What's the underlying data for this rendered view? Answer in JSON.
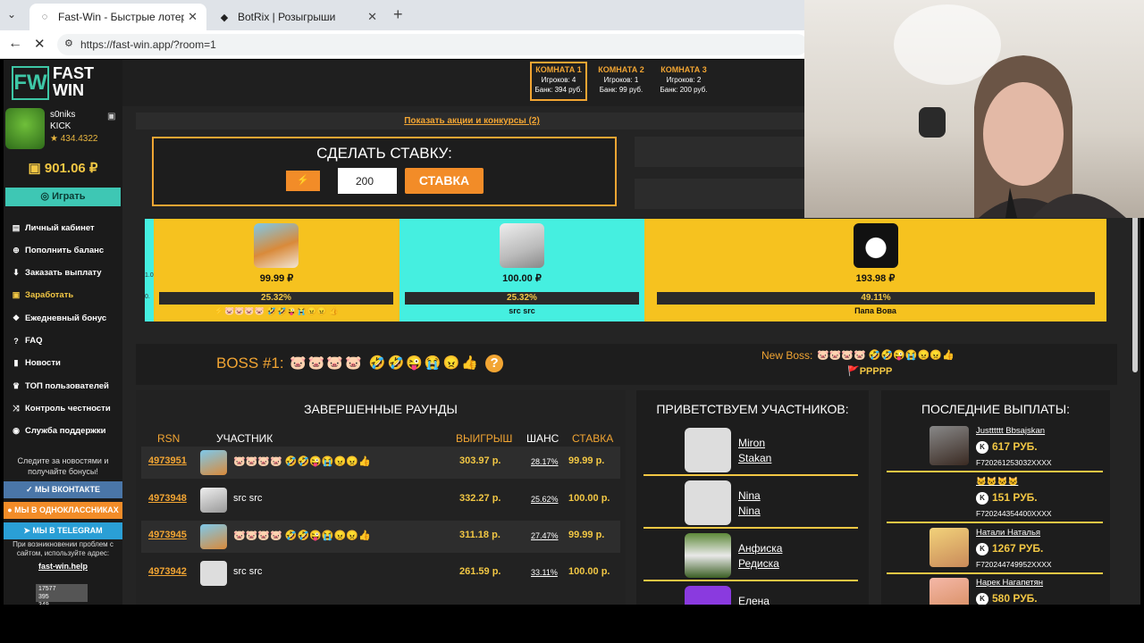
{
  "browser": {
    "tabs": [
      {
        "title": "Fast-Win - Быстрые лотереи! Ком",
        "icon": "loading-icon"
      },
      {
        "title": "BotRix | Розыгрыши",
        "icon": "botrix-icon"
      }
    ],
    "url": "https://fast-win.app/?room=1"
  },
  "logo": {
    "fw": "FW",
    "line1": "FAST",
    "line2": "WIN"
  },
  "user": {
    "name": "s0niks",
    "platform": "KICK",
    "points": "★ 434.4322",
    "balance": "901.06 ₽",
    "play": "Играть"
  },
  "menu": [
    {
      "label": "Личный кабинет",
      "icon": "wallet-icon",
      "glyph": "▤"
    },
    {
      "label": "Пополнить баланс",
      "icon": "plus-circle-icon",
      "glyph": "⊕"
    },
    {
      "label": "Заказать выплату",
      "icon": "download-icon",
      "glyph": "⬇"
    },
    {
      "label": "Заработать",
      "icon": "cash-icon",
      "glyph": "▣"
    },
    {
      "label": "Ежедневный бонус",
      "icon": "gift-icon",
      "glyph": "❖"
    },
    {
      "label": "FAQ",
      "icon": "question-icon",
      "glyph": "?"
    },
    {
      "label": "Новости",
      "icon": "bookmark-icon",
      "glyph": "▮"
    },
    {
      "label": "ТОП пользователей",
      "icon": "trophy-icon",
      "glyph": "♛"
    },
    {
      "label": "Контроль честности",
      "icon": "shuffle-icon",
      "glyph": "⤨"
    },
    {
      "label": "Служба поддержки",
      "icon": "support-icon",
      "glyph": "◉"
    }
  ],
  "follow": {
    "line1": "Следите за новостями и",
    "line2": "получайте бонусы!"
  },
  "social": [
    {
      "label": "МЫ ВКОНТАКТЕ",
      "color": "#4a76a8"
    },
    {
      "label": "МЫ В ОДНОКЛАССНИКАХ",
      "color": "#f28c28"
    },
    {
      "label": "МЫ В TELEGRAM",
      "color": "#2a9fd6"
    }
  ],
  "help": {
    "line1": "При возникновении проблем с",
    "line2": "сайтом, используйте адрес:",
    "link": "fast-win.help"
  },
  "badge": {
    "line1": "17577",
    "line2": "395",
    "line3": "349"
  },
  "rooms": [
    {
      "name": "КОМНАТА 1",
      "players": "Игроков: 4",
      "bank": "Банк: 394 руб."
    },
    {
      "name": "КОМНАТА 2",
      "players": "Игроков: 1",
      "bank": "Банк: 99 руб."
    },
    {
      "name": "КОМНАТА 3",
      "players": "Игроков: 2",
      "bank": "Банк: 200 руб."
    }
  ],
  "promo": "Показать акции и конкурсы (2)",
  "bet": {
    "title": "СДЕЛАТЬ СТАВКУ:",
    "value": "200",
    "button": "СТАВКА",
    "bolt": "⚡"
  },
  "players": [
    {
      "amount": "99.99 ₽",
      "percent": "25.32%",
      "share": 0.2532,
      "name": "⚡🐷🐷🐷🐷 🤣🤣😜😭😠😠 👍",
      "bg": "#f6c21f",
      "bar": "#2a2a2a"
    },
    {
      "amount": "100.00 ₽",
      "percent": "25.32%",
      "share": 0.2532,
      "name": "src src",
      "bg": "#45efe0",
      "bar": "#2a2a2a"
    },
    {
      "amount": "193.98 ₽",
      "percent": "49.11%",
      "share": 0.4911,
      "name": "Папа Вова",
      "bg": "#f6c21f",
      "bar": "#2a2a2a"
    }
  ],
  "strip_left": {
    "a": "1.0",
    "b": "0."
  },
  "boss": {
    "label": "BOSS #1:",
    "emoji": "🐷🐷🐷🐷 🤣🤣😜😭😠👍",
    "help": "?",
    "newboss_label": "New Boss:",
    "newboss_emoji": "🐷🐷🐷🐷 🤣🤣😜😭😠😠👍",
    "flag": "🚩PPPPP"
  },
  "rounds": {
    "title": "ЗАВЕРШЕННЫЕ РАУНДЫ",
    "headers": {
      "rsn": "RSN",
      "player": "УЧАСТНИК",
      "win": "ВЫИГРЫШ",
      "chance": "ШАНС",
      "bet": "СТАВКА"
    },
    "rows": [
      {
        "id": "4973951",
        "name": "🐷🐷🐷🐷 🤣🤣😜😭😠😠👍",
        "win": "303.97 р.",
        "chance": "28.17%",
        "bet": "99.99 р."
      },
      {
        "id": "4973948",
        "name": "src src",
        "win": "332.27 р.",
        "chance": "25.62%",
        "bet": "100.00 р."
      },
      {
        "id": "4973945",
        "name": "🐷🐷🐷🐷 🤣🤣😜😭😠😠👍",
        "win": "311.18 р.",
        "chance": "27.47%",
        "bet": "99.99 р."
      },
      {
        "id": "4973942",
        "name": "src src",
        "win": "261.59 р.",
        "chance": "33.11%",
        "bet": "100.00 р."
      }
    ]
  },
  "welcome": {
    "title": "ПРИВЕТСТВУЕМ УЧАСТНИКОВ:",
    "users": [
      {
        "first": "Miron",
        "last": "Stakan"
      },
      {
        "first": "Nina",
        "last": "Nina"
      },
      {
        "first": "Анфиска",
        "last": "Редиска"
      },
      {
        "first": "Елена",
        "last": ""
      }
    ]
  },
  "payouts": {
    "title": "ПОСЛЕДНИЕ ВЫПЛАТЫ:",
    "items": [
      {
        "name": "Justttttt Bbsajskan",
        "amount": "617 РУБ.",
        "code": "F720261253032XXXX"
      },
      {
        "name": "🐱🐱🐱🐱",
        "amount": "151 РУБ.",
        "code": "F720244354400XXXX"
      },
      {
        "name": "Натали Наталья",
        "amount": "1267 РУБ.",
        "code": "F720244749952XXXX"
      },
      {
        "name": "Нарек Нагапетян",
        "amount": "580 РУБ.",
        "code": ""
      }
    ]
  }
}
